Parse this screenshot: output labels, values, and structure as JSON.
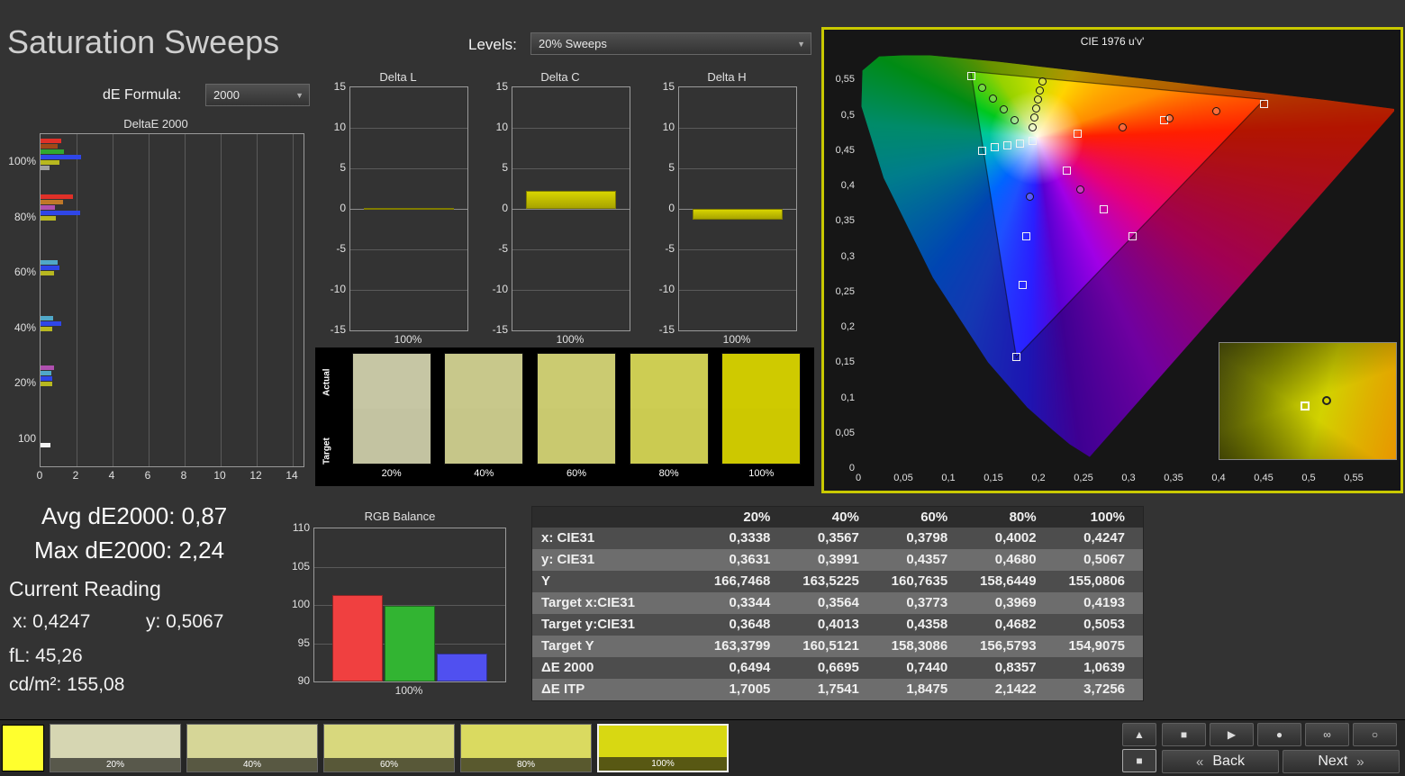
{
  "page": {
    "title": "Saturation Sweeps"
  },
  "controls": {
    "de_formula_label": "dE Formula:",
    "de_formula_value": "2000",
    "levels_label": "Levels:",
    "levels_value": "20% Sweeps"
  },
  "stats": {
    "avg": "Avg dE2000: 0,87",
    "max": "Max dE2000: 2,24",
    "current_reading": "Current Reading",
    "x_line": "x: 0,4247",
    "y_line": "y: 0,5067",
    "fl_line": "fL: 45,26",
    "cd_line": "cd/m²: 155,08"
  },
  "chart_data": [
    {
      "id": "deltae2000",
      "type": "bar",
      "orientation": "horizontal",
      "title": "DeltaE 2000",
      "xticks": [
        0,
        2,
        4,
        6,
        8,
        10,
        12,
        14
      ],
      "xlim": [
        0,
        14.6
      ],
      "groups": [
        {
          "label": "100%",
          "bars": [
            {
              "slot": 0,
              "color": "#e03028",
              "value": 1.15
            },
            {
              "slot": 1,
              "color": "#a04818",
              "value": 0.95
            },
            {
              "slot": 2,
              "color": "#30a830",
              "value": 1.3
            },
            {
              "slot": 3,
              "color": "#2f46e8",
              "value": 2.24
            },
            {
              "slot": 4,
              "color": "#b8b820",
              "value": 1.06
            },
            {
              "slot": 5,
              "color": "#a0a0a0",
              "value": 0.5
            }
          ]
        },
        {
          "label": "80%",
          "bars": [
            {
              "slot": 0,
              "color": "#e03028",
              "value": 1.8
            },
            {
              "slot": 1,
              "color": "#c07828",
              "value": 1.25
            },
            {
              "slot": 2,
              "color": "#b050b0",
              "value": 0.8
            },
            {
              "slot": 3,
              "color": "#2f46e8",
              "value": 2.2
            },
            {
              "slot": 4,
              "color": "#b8b820",
              "value": 0.84
            }
          ]
        },
        {
          "label": "60%",
          "bars": [
            {
              "slot": 2,
              "color": "#50a8c8",
              "value": 0.95
            },
            {
              "slot": 3,
              "color": "#2f46e8",
              "value": 1.05
            },
            {
              "slot": 4,
              "color": "#b8b820",
              "value": 0.74
            }
          ]
        },
        {
          "label": "40%",
          "bars": [
            {
              "slot": 2,
              "color": "#50a8c8",
              "value": 0.7
            },
            {
              "slot": 3,
              "color": "#2f46e8",
              "value": 1.15
            },
            {
              "slot": 4,
              "color": "#b8b820",
              "value": 0.67
            }
          ]
        },
        {
          "label": "20%",
          "bars": [
            {
              "slot": 1,
              "color": "#b050b0",
              "value": 0.75
            },
            {
              "slot": 2,
              "color": "#50a8c8",
              "value": 0.6
            },
            {
              "slot": 3,
              "color": "#2f46e8",
              "value": 0.65
            },
            {
              "slot": 4,
              "color": "#b8b820",
              "value": 0.65
            }
          ]
        },
        {
          "label": "100",
          "bars": [
            {
              "slot": 5,
              "color": "#f2f2f2",
              "value": 0.55
            }
          ]
        }
      ]
    },
    {
      "id": "delta_l",
      "type": "bar",
      "title": "Delta L",
      "ylim": [
        -15,
        15
      ],
      "yticks": [
        15,
        10,
        5,
        0,
        -5,
        -10,
        -15
      ],
      "xlabel": "100%",
      "value": 0.1,
      "color": "#c2be00"
    },
    {
      "id": "delta_c",
      "type": "bar",
      "title": "Delta C",
      "ylim": [
        -15,
        15
      ],
      "yticks": [
        15,
        10,
        5,
        0,
        -5,
        -10,
        -15
      ],
      "xlabel": "100%",
      "value": 2.2,
      "color": "#c2be00"
    },
    {
      "id": "delta_h",
      "type": "bar",
      "title": "Delta H",
      "ylim": [
        -15,
        15
      ],
      "yticks": [
        15,
        10,
        5,
        0,
        -5,
        -10,
        -15
      ],
      "xlabel": "100%",
      "value": -1.3,
      "color": "#c2be00"
    },
    {
      "id": "rgb_balance",
      "type": "bar",
      "title": "RGB Balance",
      "categories": [
        "Red",
        "Green",
        "Blue"
      ],
      "values": [
        101.3,
        99.9,
        93.6
      ],
      "colors": [
        "#f04040",
        "#32b432",
        "#5050f0"
      ],
      "ylim": [
        90,
        110
      ],
      "yticks": [
        110,
        105,
        100,
        95,
        90
      ],
      "xlabel": "100%"
    },
    {
      "id": "cie",
      "type": "scatter",
      "title": "CIE 1976 u'v'",
      "xlim": [
        0,
        0.595
      ],
      "ylim": [
        0,
        0.586
      ],
      "xtick_values": [
        0,
        0.05,
        0.1,
        0.15,
        0.2,
        0.25,
        0.3,
        0.35,
        0.4,
        0.45,
        0.5,
        0.55
      ],
      "xtick_labels": [
        "0",
        "0,05",
        "0,1",
        "0,15",
        "0,2",
        "0,25",
        "0,3",
        "0,35",
        "0,4",
        "0,45",
        "0,5",
        "0,55"
      ],
      "ytick_values": [
        0,
        0.05,
        0.1,
        0.15,
        0.2,
        0.25,
        0.3,
        0.35,
        0.4,
        0.45,
        0.5,
        0.55
      ],
      "ytick_labels": [
        "0",
        "0,05",
        "0,1",
        "0,15",
        "0,2",
        "0,25",
        "0,3",
        "0,35",
        "0,4",
        "0,45",
        "0,5",
        "0,55"
      ],
      "gamut_triangle": [
        [
          0.125,
          0.5625
        ],
        [
          0.4507,
          0.5229
        ],
        [
          0.1754,
          0.1579
        ]
      ],
      "white_point": [
        0.1978,
        0.4683
      ],
      "markers": [
        {
          "u": 0.125,
          "v": 0.556,
          "t": "s"
        },
        {
          "u": 0.137,
          "v": 0.54,
          "t": "c"
        },
        {
          "u": 0.149,
          "v": 0.524,
          "t": "c"
        },
        {
          "u": 0.161,
          "v": 0.509,
          "t": "c"
        },
        {
          "u": 0.173,
          "v": 0.494,
          "t": "c"
        },
        {
          "u": 0.204,
          "v": 0.549,
          "t": "c"
        },
        {
          "u": 0.201,
          "v": 0.536,
          "t": "c"
        },
        {
          "u": 0.199,
          "v": 0.523,
          "t": "c"
        },
        {
          "u": 0.197,
          "v": 0.51,
          "t": "c"
        },
        {
          "u": 0.195,
          "v": 0.497,
          "t": "c"
        },
        {
          "u": 0.193,
          "v": 0.484,
          "t": "c"
        },
        {
          "u": 0.137,
          "v": 0.451,
          "t": "s"
        },
        {
          "u": 0.151,
          "v": 0.455,
          "t": "s"
        },
        {
          "u": 0.165,
          "v": 0.458,
          "t": "s"
        },
        {
          "u": 0.179,
          "v": 0.461,
          "t": "s"
        },
        {
          "u": 0.193,
          "v": 0.464,
          "t": "s"
        },
        {
          "u": 0.243,
          "v": 0.475,
          "t": "s"
        },
        {
          "u": 0.293,
          "v": 0.483,
          "t": "c"
        },
        {
          "u": 0.339,
          "v": 0.494,
          "t": "s"
        },
        {
          "u": 0.345,
          "v": 0.496,
          "t": "c"
        },
        {
          "u": 0.397,
          "v": 0.506,
          "t": "c"
        },
        {
          "u": 0.45,
          "v": 0.517,
          "t": "s"
        },
        {
          "u": 0.231,
          "v": 0.423,
          "t": "s"
        },
        {
          "u": 0.246,
          "v": 0.395,
          "t": "c"
        },
        {
          "u": 0.272,
          "v": 0.367,
          "t": "s"
        },
        {
          "u": 0.304,
          "v": 0.329,
          "t": "s"
        },
        {
          "u": 0.19,
          "v": 0.385,
          "t": "c"
        },
        {
          "u": 0.186,
          "v": 0.33,
          "t": "s"
        },
        {
          "u": 0.182,
          "v": 0.261,
          "t": "s"
        },
        {
          "u": 0.175,
          "v": 0.159,
          "t": "s"
        }
      ]
    }
  ],
  "table": {
    "corner": "",
    "columns": [
      "20%",
      "40%",
      "60%",
      "80%",
      "100%"
    ],
    "rows": [
      {
        "label": "x: CIE31",
        "values": [
          "0,3338",
          "0,3567",
          "0,3798",
          "0,4002",
          "0,4247"
        ]
      },
      {
        "label": "y: CIE31",
        "values": [
          "0,3631",
          "0,3991",
          "0,4357",
          "0,4680",
          "0,5067"
        ]
      },
      {
        "label": "Y",
        "values": [
          "166,7468",
          "163,5225",
          "160,7635",
          "158,6449",
          "155,0806"
        ]
      },
      {
        "label": "Target x:CIE31",
        "values": [
          "0,3344",
          "0,3564",
          "0,3773",
          "0,3969",
          "0,4193"
        ]
      },
      {
        "label": "Target y:CIE31",
        "values": [
          "0,3648",
          "0,4013",
          "0,4358",
          "0,4682",
          "0,5053"
        ]
      },
      {
        "label": "Target Y",
        "values": [
          "163,3799",
          "160,5121",
          "158,3086",
          "156,5793",
          "154,9075"
        ]
      },
      {
        "label": "ΔE 2000",
        "values": [
          "0,6494",
          "0,6695",
          "0,7440",
          "0,8357",
          "1,0639"
        ]
      },
      {
        "label": "ΔE ITP",
        "values": [
          "1,7005",
          "1,7541",
          "1,8475",
          "2,1422",
          "3,7256"
        ]
      }
    ]
  },
  "swatch_strip": {
    "actual_label": "Actual",
    "target_label": "Target",
    "levels": [
      {
        "label": "20%",
        "actual": "#c6c6a4",
        "target": "#c3c3a1"
      },
      {
        "label": "40%",
        "actual": "#c8c88b",
        "target": "#c6c689"
      },
      {
        "label": "60%",
        "actual": "#cbcb71",
        "target": "#c9c96f"
      },
      {
        "label": "80%",
        "actual": "#cdcd53",
        "target": "#cbcb51"
      },
      {
        "label": "100%",
        "actual": "#cfca00",
        "target": "#cdc800"
      }
    ]
  },
  "bottom_bar": {
    "patch_color": "#ffff2e",
    "swatches": [
      {
        "label": "20%",
        "color": "#d6d6b2",
        "selected": false
      },
      {
        "label": "40%",
        "color": "#d6d697",
        "selected": false
      },
      {
        "label": "60%",
        "color": "#d8d87d",
        "selected": false
      },
      {
        "label": "80%",
        "color": "#dada60",
        "selected": false
      },
      {
        "label": "100%",
        "color": "#d8d812",
        "selected": true
      }
    ],
    "side_buttons": [
      {
        "name": "pattern-up",
        "glyph": "▲"
      },
      {
        "name": "pattern-window",
        "glyph": "■"
      }
    ],
    "transport": [
      {
        "name": "stop",
        "glyph": "■"
      },
      {
        "name": "play",
        "glyph": "▶"
      },
      {
        "name": "record",
        "glyph": "●"
      },
      {
        "name": "continuous-read",
        "glyph": "∞"
      },
      {
        "name": "single-read",
        "glyph": "○"
      }
    ],
    "back_chevron": "«",
    "back_label": "Back",
    "next_label": "Next",
    "next_chevron": "»"
  }
}
